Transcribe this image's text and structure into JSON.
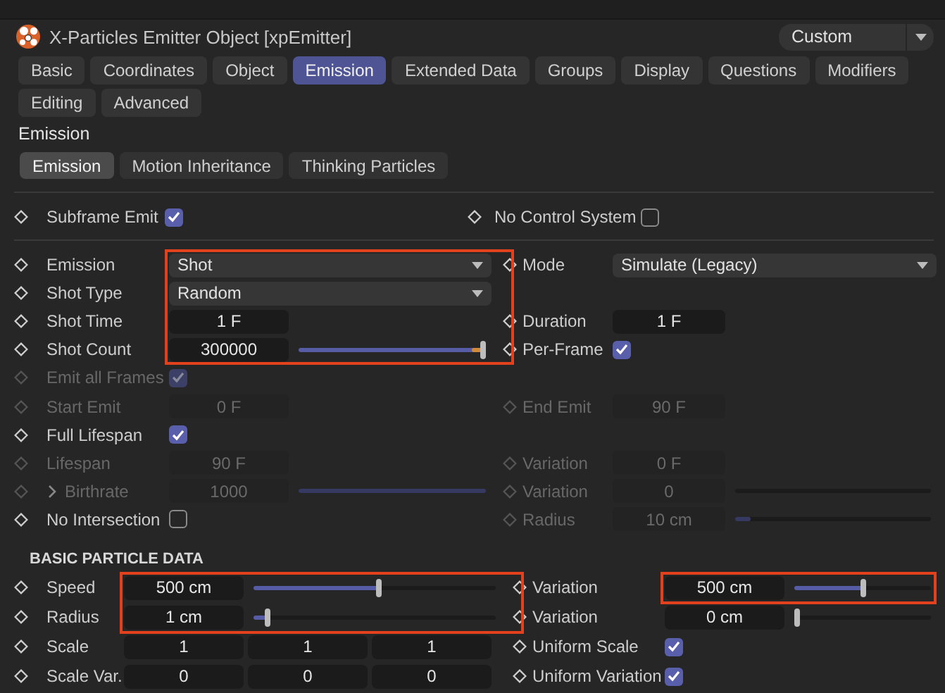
{
  "window": {
    "title": "X-Particles Emitter Object [xpEmitter]",
    "preset": "Custom"
  },
  "tabs": [
    {
      "label": "Basic",
      "selected": false
    },
    {
      "label": "Coordinates",
      "selected": false
    },
    {
      "label": "Object",
      "selected": false
    },
    {
      "label": "Emission",
      "selected": true
    },
    {
      "label": "Extended Data",
      "selected": false
    },
    {
      "label": "Groups",
      "selected": false
    },
    {
      "label": "Display",
      "selected": false
    },
    {
      "label": "Questions",
      "selected": false
    },
    {
      "label": "Modifiers",
      "selected": false
    },
    {
      "label": "Editing",
      "selected": false
    },
    {
      "label": "Advanced",
      "selected": false
    }
  ],
  "section_title": "Emission",
  "subtabs": [
    {
      "label": "Emission",
      "selected": true
    },
    {
      "label": "Motion Inheritance",
      "selected": false
    },
    {
      "label": "Thinking Particles",
      "selected": false
    }
  ],
  "groups": [
    {
      "rows": [
        {
          "left": {
            "label": "Subframe Emit",
            "kind": "checkbox",
            "checked": true,
            "disabled": false,
            "highlighted": false
          },
          "right": {
            "label": "No Control System",
            "kind": "checkbox",
            "checked": false,
            "disabled": false,
            "highlighted": false
          }
        }
      ]
    },
    {
      "rows": [
        {
          "left": {
            "label": "Emission",
            "kind": "dropdown",
            "value": "Shot",
            "disabled": false,
            "highlighted": true
          },
          "right": {
            "label": "Mode",
            "kind": "dropdown",
            "value": "Simulate (Legacy)",
            "disabled": false,
            "highlighted": false
          }
        },
        {
          "left": {
            "label": "Shot Type",
            "kind": "dropdown",
            "value": "Random",
            "disabled": false,
            "highlighted": true
          }
        },
        {
          "left": {
            "label": "Shot Time",
            "kind": "number",
            "value": "1 F",
            "disabled": false,
            "highlighted": true
          },
          "right": {
            "label": "Duration",
            "kind": "number",
            "value": "1 F",
            "disabled": false,
            "highlighted": false
          }
        },
        {
          "left": {
            "label": "Shot Count",
            "kind": "slider",
            "value": "300000",
            "level": 1,
            "over_range": true,
            "disabled": false,
            "highlighted": true
          },
          "right": {
            "label": "Per-Frame",
            "kind": "checkbox",
            "checked": true,
            "disabled": false,
            "highlighted": false
          }
        },
        {
          "left": {
            "label": "Emit all Frames",
            "kind": "checkbox",
            "checked": true,
            "disabled": true,
            "highlighted": false
          }
        },
        {
          "left": {
            "label": "Start Emit",
            "kind": "number",
            "value": "0 F",
            "disabled": true,
            "highlighted": false
          },
          "right": {
            "label": "End Emit",
            "kind": "number",
            "value": "90 F",
            "disabled": true,
            "highlighted": false
          }
        },
        {
          "left": {
            "label": "Full Lifespan",
            "kind": "checkbox",
            "checked": true,
            "disabled": false,
            "highlighted": false
          }
        },
        {
          "left": {
            "label": "Lifespan",
            "kind": "number",
            "value": "90 F",
            "disabled": true,
            "highlighted": false
          },
          "right": {
            "label": "Variation",
            "kind": "number",
            "value": "0 F",
            "disabled": true,
            "highlighted": false
          }
        },
        {
          "left": {
            "label": "Birthrate",
            "kind": "slider",
            "value": "1000",
            "level": 1,
            "over_range": false,
            "expanded": false,
            "disabled": true,
            "highlighted": false
          },
          "right": {
            "label": "Variation",
            "kind": "slider",
            "value": "0",
            "level": 0,
            "over_range": false,
            "disabled": true,
            "highlighted": false
          }
        },
        {
          "left": {
            "label": "No Intersection",
            "kind": "checkbox",
            "checked": false,
            "disabled": false,
            "highlighted": false
          },
          "right": {
            "label": "Radius",
            "kind": "slider",
            "value": "10 cm",
            "level": 0.08,
            "over_range": false,
            "disabled": true,
            "highlighted": false
          }
        }
      ]
    },
    {
      "title": "BASIC PARTICLE DATA",
      "rows": [
        {
          "left": {
            "label": "Speed",
            "kind": "slider",
            "value": "500 cm",
            "level": 0.52,
            "over_range": false,
            "disabled": false,
            "highlighted": true
          },
          "right": {
            "label": "Variation",
            "kind": "slider",
            "value": "500 cm",
            "level": 0.5,
            "over_range": false,
            "disabled": false,
            "highlighted": true
          }
        },
        {
          "left": {
            "label": "Radius",
            "kind": "slider",
            "value": "1 cm",
            "level": 0.05,
            "over_range": false,
            "disabled": false,
            "highlighted": true
          },
          "right": {
            "label": "Variation",
            "kind": "slider",
            "value": "0 cm",
            "level": 0,
            "over_range": false,
            "disabled": false,
            "highlighted": false
          }
        },
        {
          "left": {
            "label": "Scale",
            "kind": "vector",
            "values": [
              "1",
              "1",
              "1"
            ],
            "disabled": false,
            "highlighted": false
          },
          "right": {
            "label": "Uniform Scale",
            "kind": "checkbox",
            "checked": true,
            "disabled": false,
            "highlighted": false
          }
        },
        {
          "left": {
            "label": "Scale Var.",
            "kind": "vector",
            "values": [
              "0",
              "0",
              "0"
            ],
            "disabled": false,
            "highlighted": false
          },
          "right": {
            "label": "Uniform Variation",
            "kind": "checkbox",
            "checked": true,
            "disabled": false,
            "highlighted": false
          }
        }
      ]
    }
  ]
}
